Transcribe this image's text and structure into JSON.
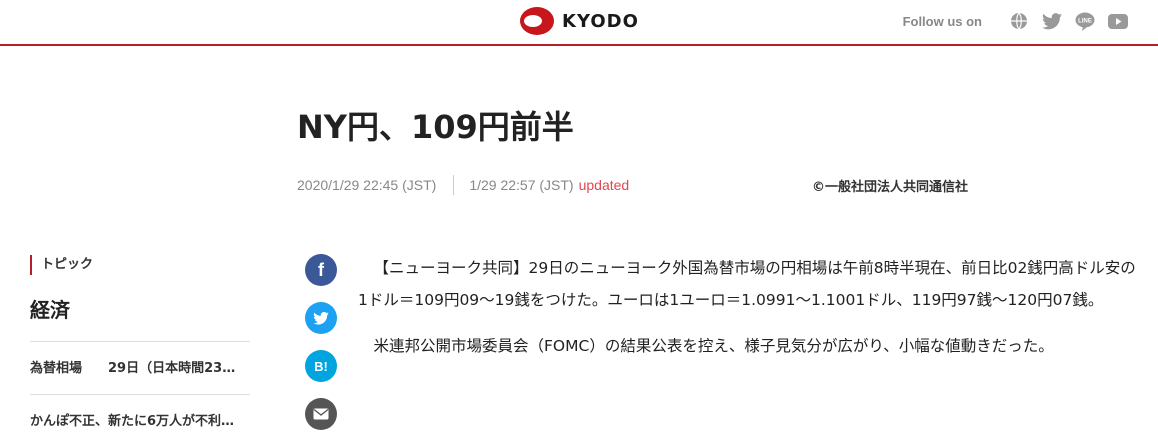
{
  "header": {
    "logo_text": "KYODO",
    "follow_label": "Follow us on",
    "social_icons": [
      "globe-icon",
      "twitter-icon",
      "line-icon",
      "youtube-icon"
    ],
    "social_line_text": "LINE"
  },
  "colors": {
    "brand": "#c8161d",
    "updated": "#e0474f",
    "facebook": "#3b5998",
    "twitter": "#1da1f2",
    "hatena": "#00a4de",
    "mail": "#555555"
  },
  "article": {
    "title": "NY円、109円前半",
    "published": "2020/1/29 22:45 (JST)",
    "modified": "1/29 22:57 (JST)",
    "updated_label": "updated",
    "copyright": "©一般社団法人共同通信社",
    "paragraphs": [
      "【ニューヨーク共同】29日のニューヨーク外国為替市場の円相場は午前8時半現在、前日比02銭円高ドル安の1ドル＝109円09～19銭をつけた。ユーロは1ユーロ＝1.0991～1.1001ドル、119円97銭～120円07銭。",
      "米連邦公開市場委員会（FOMC）の結果公表を控え、様子見気分が広がり、小幅な値動きだった。"
    ]
  },
  "share": {
    "facebook": "f",
    "hatena": "B!"
  },
  "sidebar": {
    "topic_label": "トピック",
    "topic_name": "経済",
    "items": [
      {
        "category": "為替相場",
        "headline": "29日（日本時間23…"
      },
      {
        "category": "",
        "headline": "かんぽ不正、新たに6万人が不利…"
      }
    ]
  }
}
